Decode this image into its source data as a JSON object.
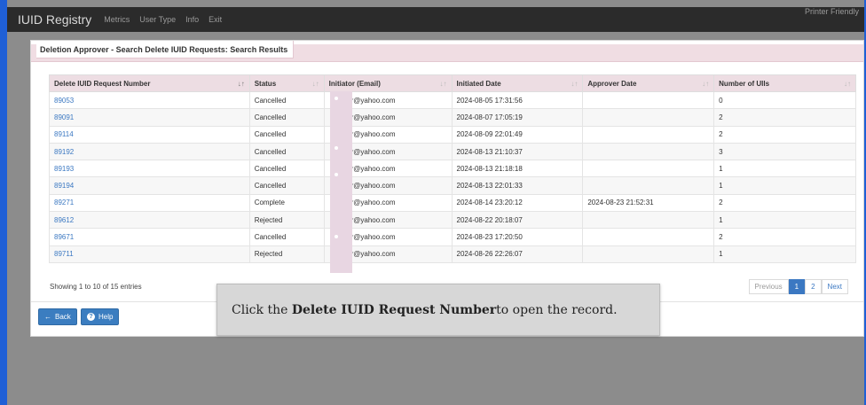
{
  "navbar": {
    "brand": "IUID Registry",
    "links": [
      "Metrics",
      "User Type",
      "Info",
      "Exit"
    ],
    "printer": "Printer Friendly"
  },
  "panel": {
    "title": "Deletion Approver - Search Delete IUID Requests: Search Results"
  },
  "table": {
    "headers": [
      "Delete IUID Request Number",
      "Status",
      "Initiator (Email)",
      "Initiated Date",
      "Approver Date",
      "Number of UIIs"
    ],
    "rows": [
      {
        "id": "89053",
        "status": "Cancelled",
        "email": "r@yahoo.com",
        "initiated": "2024-08-05 17:31:56",
        "approved": "",
        "count": "0"
      },
      {
        "id": "89091",
        "status": "Cancelled",
        "email": "r@yahoo.com",
        "initiated": "2024-08-07 17:05:19",
        "approved": "",
        "count": "2"
      },
      {
        "id": "89114",
        "status": "Cancelled",
        "email": "r@yahoo.com",
        "initiated": "2024-08-09 22:01:49",
        "approved": "",
        "count": "2"
      },
      {
        "id": "89192",
        "status": "Cancelled",
        "email": "r@yahoo.com",
        "initiated": "2024-08-13 21:10:37",
        "approved": "",
        "count": "3"
      },
      {
        "id": "89193",
        "status": "Cancelled",
        "email": "r@yahoo.com",
        "initiated": "2024-08-13 21:18:18",
        "approved": "",
        "count": "1"
      },
      {
        "id": "89194",
        "status": "Cancelled",
        "email": "r@yahoo.com",
        "initiated": "2024-08-13 22:01:33",
        "approved": "",
        "count": "1"
      },
      {
        "id": "89271",
        "status": "Complete",
        "email": "r@yahoo.com",
        "initiated": "2024-08-14 23:20:12",
        "approved": "2024-08-23 21:52:31",
        "count": "2"
      },
      {
        "id": "89612",
        "status": "Rejected",
        "email": "r@yahoo.com",
        "initiated": "2024-08-22 20:18:07",
        "approved": "",
        "count": "1"
      },
      {
        "id": "89671",
        "status": "Cancelled",
        "email": "r@yahoo.com",
        "initiated": "2024-08-23 17:20:50",
        "approved": "",
        "count": "2"
      },
      {
        "id": "89711",
        "status": "Rejected",
        "email": "r@yahoo.com",
        "initiated": "2024-08-26 22:26:07",
        "approved": "",
        "count": "1"
      }
    ]
  },
  "footer": {
    "entries_text": "Showing 1 to 10 of 15 entries",
    "pager": {
      "previous": "Previous",
      "pages": [
        "1",
        "2"
      ],
      "next": "Next"
    }
  },
  "buttons": {
    "back": "Back",
    "help": "Help"
  },
  "tooltip": {
    "prefix": "Click the ",
    "emphasis": "Delete IUID Request Number",
    "suffix": " to open the record."
  },
  "colors": {
    "accent": "#3b78c2",
    "header_bg": "#eddde3"
  }
}
